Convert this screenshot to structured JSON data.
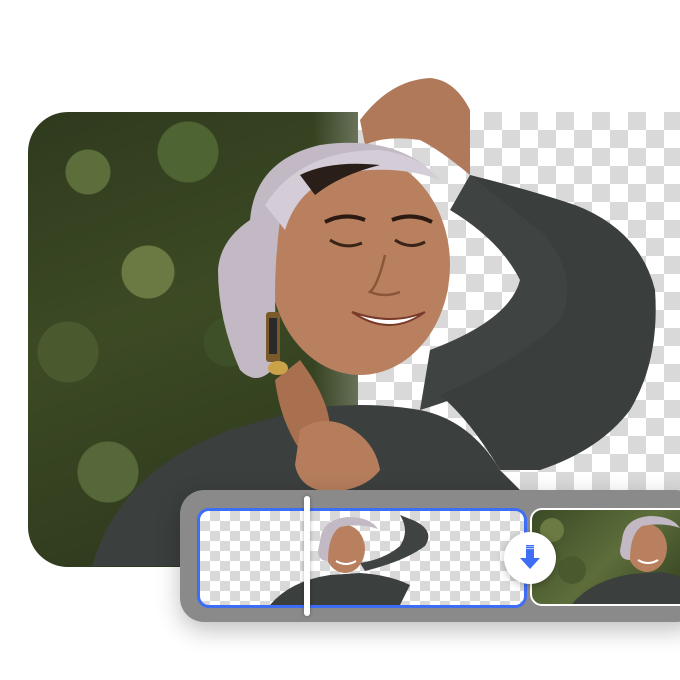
{
  "editor": {
    "mode": "background-removal",
    "accent_color": "#3d6ef5",
    "transparent_pattern": "checkerboard",
    "thumbnails": [
      {
        "kind": "background-removed",
        "selected": true
      },
      {
        "kind": "original",
        "selected": false
      }
    ],
    "download_icon": "arrow-down-icon"
  }
}
